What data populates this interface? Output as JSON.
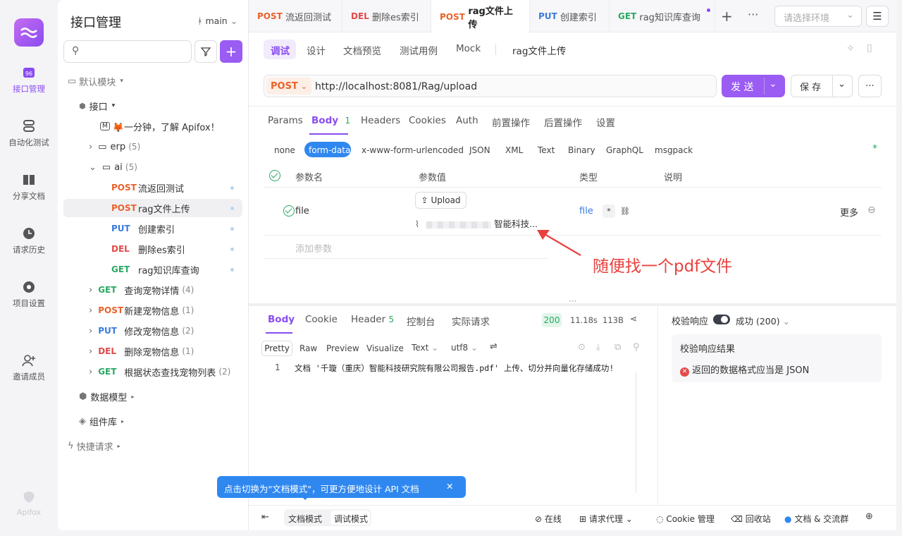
{
  "nav": {
    "items": [
      {
        "label": "接口管理",
        "icon": "api-icon"
      },
      {
        "label": "自动化测试",
        "icon": "automation-icon"
      },
      {
        "label": "分享文档",
        "icon": "book-icon"
      },
      {
        "label": "请求历史",
        "icon": "clock-icon"
      },
      {
        "label": "项目设置",
        "icon": "settings-icon"
      },
      {
        "label": "邀请成员",
        "icon": "add-user-icon"
      }
    ],
    "brand": "Apifox"
  },
  "panel": {
    "title": "接口管理",
    "branch": "main",
    "search_placeholder": "",
    "default_module": "默认模块",
    "api_root": "接口",
    "intro": "🦊一分钟，了解 Apifox！",
    "folders": [
      {
        "name": "erp",
        "count": "(5)"
      },
      {
        "name": "ai",
        "count": "(5)"
      }
    ],
    "ai_items": [
      {
        "method": "POST",
        "name": "流返回测试"
      },
      {
        "method": "POST",
        "name": "rag文件上传"
      },
      {
        "method": "PUT",
        "name": "创建索引"
      },
      {
        "method": "DEL",
        "name": "删除es索引"
      },
      {
        "method": "GET",
        "name": "rag知识库查询"
      }
    ],
    "root_items": [
      {
        "method": "GET",
        "name": "查询宠物详情",
        "count": "(4)"
      },
      {
        "method": "POST",
        "name": "新建宠物信息",
        "count": "(1)"
      },
      {
        "method": "PUT",
        "name": "修改宠物信息",
        "count": "(2)"
      },
      {
        "method": "DEL",
        "name": "删除宠物信息",
        "count": "(1)"
      },
      {
        "method": "GET",
        "name": "根据状态查找宠物列表",
        "count": "(2)"
      }
    ],
    "data_model": "数据模型",
    "components": "组件库",
    "quick_request": "快捷请求"
  },
  "tabs": [
    {
      "method": "POST",
      "name": "流返回测试"
    },
    {
      "method": "DEL",
      "name": "删除es索引"
    },
    {
      "method": "POST",
      "name": "rag文件上传"
    },
    {
      "method": "PUT",
      "name": "创建索引"
    },
    {
      "method": "GET",
      "name": "rag知识库查询"
    }
  ],
  "env_placeholder": "请选择环境",
  "subtabs": [
    "调试",
    "设计",
    "文档预览",
    "测试用例",
    "Mock"
  ],
  "api_name": "rag文件上传",
  "request": {
    "method": "POST",
    "url": "http://localhost:8081/Rag/upload",
    "send": "发 送",
    "save": "保 存"
  },
  "param_tabs": [
    "Params",
    "Body",
    "Headers",
    "Cookies",
    "Auth",
    "前置操作",
    "后置操作",
    "设置"
  ],
  "body_count": "1",
  "body_types": [
    "none",
    "form-data",
    "x-www-form-urlencoded",
    "JSON",
    "XML",
    "Text",
    "Binary",
    "GraphQL",
    "msgpack"
  ],
  "table": {
    "headers": [
      "参数名",
      "参数值",
      "类型",
      "说明"
    ],
    "row": {
      "name": "file",
      "upload": "Upload",
      "file_name": "智能科技...",
      "type": "file",
      "more": "更多"
    },
    "add_param": "添加参数"
  },
  "annotation": "随便找一个pdf文件",
  "response": {
    "tabs": [
      "Body",
      "Cookie",
      "Header",
      "控制台",
      "实际请求"
    ],
    "header_count": "5",
    "status": "200",
    "time": "11.18s",
    "size": "113B",
    "view_modes": [
      "Pretty",
      "Raw",
      "Preview",
      "Visualize"
    ],
    "format": "Text",
    "encoding": "utf8",
    "line_no": "1",
    "body": "文档 '千璇（重庆）智能科技研究院有限公司报告.pdf' 上传、切分并向量化存储成功!"
  },
  "validate": {
    "label": "校验响应",
    "status": "成功 (200)",
    "result_title": "校验响应结果",
    "error": "返回的数据格式应当是 JSON"
  },
  "tooltip": "点击切换为\"文档模式\"，可更方便地设计 API 文档",
  "footer": {
    "doc_mode": "文档模式",
    "debug_mode": "调试模式",
    "online": "在线",
    "proxy": "请求代理",
    "cookie": "Cookie 管理",
    "trash": "回收站",
    "community": "文档 & 交流群"
  },
  "colors": {
    "accent": "#8a4cf0",
    "post": "#e8622c",
    "get": "#2aa864",
    "put": "#3a7be0",
    "del": "#e24a4a",
    "tooltip": "#2f88f0",
    "annotation_red": "#e8423f"
  }
}
